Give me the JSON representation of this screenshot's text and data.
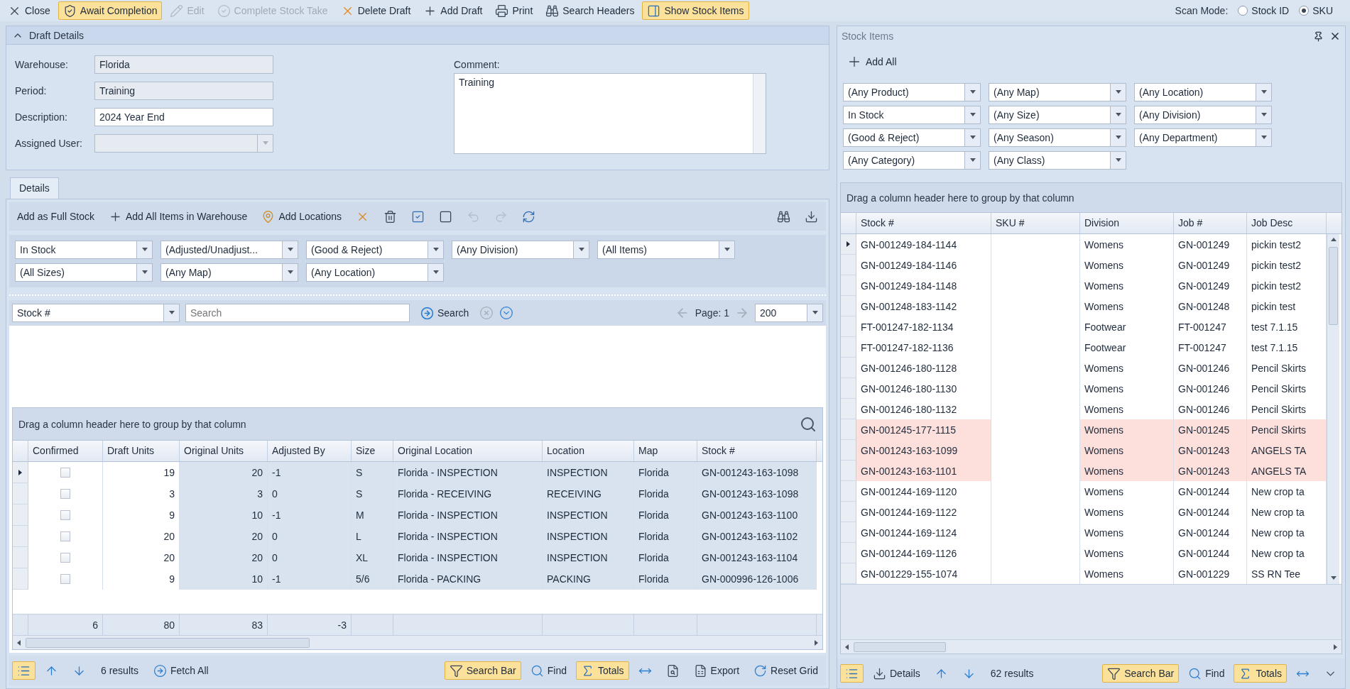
{
  "toolbar": [
    {
      "kind": "close",
      "label": "Close",
      "active": false,
      "disabled": false
    },
    {
      "kind": "await",
      "label": "Await Completion",
      "active": true,
      "disabled": false
    },
    {
      "kind": "edit",
      "label": "Edit",
      "active": false,
      "disabled": true
    },
    {
      "kind": "complete",
      "label": "Complete Stock Take",
      "active": false,
      "disabled": true
    },
    {
      "kind": "delete",
      "label": "Delete Draft",
      "active": false,
      "disabled": false
    },
    {
      "kind": "add",
      "label": "Add Draft",
      "active": false,
      "disabled": false
    },
    {
      "kind": "print",
      "label": "Print",
      "active": false,
      "disabled": false
    },
    {
      "kind": "headers",
      "label": "Search Headers",
      "active": false,
      "disabled": false
    },
    {
      "kind": "items",
      "label": "Show Stock Items",
      "active": true,
      "disabled": false
    }
  ],
  "scan_mode": {
    "label": "Scan Mode:",
    "options": [
      {
        "label": "Stock ID",
        "selected": false
      },
      {
        "label": "SKU",
        "selected": true
      }
    ]
  },
  "draft_details": {
    "title": "Draft Details",
    "expanded": true,
    "fields": [
      {
        "label": "Warehouse:",
        "value": "Florida",
        "kind": "readonly"
      },
      {
        "label": "Period:",
        "value": "Training",
        "kind": "readonly"
      },
      {
        "label": "Description:",
        "value": "2024 Year End",
        "kind": "text"
      },
      {
        "label": "Assigned User:",
        "kind": "dropdown"
      }
    ],
    "comment": {
      "label": "Comment:",
      "value": "Training"
    }
  },
  "tabs": [
    {
      "label": "Details",
      "selected": true
    }
  ],
  "details_toolbar": [
    {
      "kind": "fullstock",
      "label": "Add as Full Stock",
      "disabled": false
    },
    {
      "kind": "addall",
      "label": "Add All Items in Warehouse",
      "disabled": false
    },
    {
      "kind": "locations",
      "label": "Add Locations",
      "disabled": false
    },
    {
      "kind": "cancel",
      "disabled": false
    },
    {
      "kind": "trash",
      "disabled": false
    },
    {
      "kind": "checkall",
      "disabled": false
    },
    {
      "kind": "uncheckall",
      "disabled": false
    },
    {
      "kind": "undo",
      "disabled": true
    },
    {
      "kind": "redo",
      "disabled": true
    },
    {
      "kind": "refresh",
      "disabled": false
    },
    {
      "kind": "binoculars",
      "disabled": false
    },
    {
      "kind": "download",
      "disabled": false
    }
  ],
  "filters": [
    "In Stock",
    "(Adjusted/Unadjust...",
    "(Good & Reject)",
    "(Any Division)",
    "(All Items)",
    "(All Sizes)",
    "(Any Map)",
    "(Any Location)"
  ],
  "search": {
    "field": "Stock #",
    "placeholder": "Search",
    "button": "Search",
    "page": "Page: 1",
    "page_size": "200"
  },
  "grid": {
    "group_hint": "Drag a column header here to group by that column",
    "columns": [
      {
        "label": "Confirmed",
        "kind": "check",
        "editable": true
      },
      {
        "label": "Draft Units",
        "kind": "number",
        "editable": true
      },
      {
        "label": "Original Units",
        "kind": "number",
        "editable": false
      },
      {
        "label": "Adjusted By",
        "kind": "text",
        "editable": false
      },
      {
        "label": "Size",
        "kind": "text",
        "editable": false
      },
      {
        "label": "Original Location",
        "kind": "text",
        "editable": false
      },
      {
        "label": "Location",
        "kind": "text",
        "editable": false
      },
      {
        "label": "Map",
        "kind": "text",
        "editable": false
      },
      {
        "label": "Stock #",
        "kind": "text",
        "editable": false
      }
    ],
    "rows": [
      {
        "selected": true,
        "confirmed": false,
        "values": [
          "19",
          "20",
          "-1",
          "S",
          "Florida - INSPECTION",
          "INSPECTION",
          "Florida",
          "GN-001243-163-1098"
        ]
      },
      {
        "selected": false,
        "confirmed": false,
        "values": [
          "3",
          "3",
          "0",
          "S",
          "Florida - RECEIVING",
          "RECEIVING",
          "Florida",
          "GN-001243-163-1098"
        ]
      },
      {
        "selected": false,
        "confirmed": false,
        "values": [
          "9",
          "10",
          "-1",
          "M",
          "Florida - INSPECTION",
          "INSPECTION",
          "Florida",
          "GN-001243-163-1100"
        ]
      },
      {
        "selected": false,
        "confirmed": false,
        "values": [
          "20",
          "20",
          "0",
          "L",
          "Florida - INSPECTION",
          "INSPECTION",
          "Florida",
          "GN-001243-163-1102"
        ]
      },
      {
        "selected": false,
        "confirmed": false,
        "values": [
          "20",
          "20",
          "0",
          "XL",
          "Florida - INSPECTION",
          "INSPECTION",
          "Florida",
          "GN-001243-163-1104"
        ]
      },
      {
        "selected": false,
        "confirmed": false,
        "values": [
          "9",
          "10",
          "-1",
          "5/6",
          "Florida - PACKING",
          "PACKING",
          "Florida",
          "GN-000996-126-1006"
        ]
      }
    ],
    "totals": [
      "6",
      "80",
      "83",
      "-3"
    ]
  },
  "grid_bar": [
    {
      "kind": "list",
      "active": true
    },
    {
      "kind": "up",
      "active": false
    },
    {
      "kind": "down",
      "active": false
    },
    {
      "kind": "count",
      "label": "6 results",
      "active": false
    },
    {
      "kind": "fetch",
      "label": "Fetch All",
      "active": false
    },
    {
      "kind": "searchbar",
      "label": "Search Bar",
      "active": true
    },
    {
      "kind": "find",
      "label": "Find",
      "active": false
    },
    {
      "kind": "totals",
      "label": "Totals",
      "active": true
    },
    {
      "kind": "fit",
      "active": false
    },
    {
      "kind": "preview",
      "active": false
    },
    {
      "kind": "export",
      "label": "Export",
      "active": false
    },
    {
      "kind": "reset",
      "label": "Reset Grid",
      "active": false
    }
  ],
  "stock_panel": {
    "title": "Stock Items",
    "add_all": "Add All",
    "filters": [
      "(Any Product)",
      "(Any Map)",
      "(Any Location)",
      "In Stock",
      "(Any Size)",
      "(Any Division)",
      "(Good & Reject)",
      "(Any Season)",
      "(Any Department)",
      "(Any Category)",
      "(Any Class)"
    ],
    "group_hint": "Drag a column header here to group by that column",
    "columns": [
      {
        "label": "Stock #",
        "kind": "text"
      },
      {
        "label": "SKU #",
        "kind": "blank"
      },
      {
        "label": "Division",
        "kind": "text"
      },
      {
        "label": "Job #",
        "kind": "text"
      },
      {
        "label": "Job Desc",
        "kind": "text"
      }
    ],
    "rows": [
      {
        "stock": "GN-001249-184-1144",
        "division": "Womens",
        "job": "GN-001249",
        "desc": "pickin test2",
        "selected": true,
        "highlighted": false
      },
      {
        "stock": "GN-001249-184-1146",
        "division": "Womens",
        "job": "GN-001249",
        "desc": "pickin test2",
        "selected": false,
        "highlighted": false
      },
      {
        "stock": "GN-001249-184-1148",
        "division": "Womens",
        "job": "GN-001249",
        "desc": "pickin test2",
        "selected": false,
        "highlighted": false
      },
      {
        "stock": "GN-001248-183-1142",
        "division": "Womens",
        "job": "GN-001248",
        "desc": "pickin test",
        "selected": false,
        "highlighted": false
      },
      {
        "stock": "FT-001247-182-1134",
        "division": "Footwear",
        "job": "FT-001247",
        "desc": "test 7.1.15",
        "selected": false,
        "highlighted": false
      },
      {
        "stock": "FT-001247-182-1136",
        "division": "Footwear",
        "job": "FT-001247",
        "desc": "test 7.1.15",
        "selected": false,
        "highlighted": false
      },
      {
        "stock": "GN-001246-180-1128",
        "division": "Womens",
        "job": "GN-001246",
        "desc": "Pencil Skirts",
        "selected": false,
        "highlighted": false
      },
      {
        "stock": "GN-001246-180-1130",
        "division": "Womens",
        "job": "GN-001246",
        "desc": "Pencil Skirts",
        "selected": false,
        "highlighted": false
      },
      {
        "stock": "GN-001246-180-1132",
        "division": "Womens",
        "job": "GN-001246",
        "desc": "Pencil Skirts",
        "selected": false,
        "highlighted": false
      },
      {
        "stock": "GN-001245-177-1115",
        "division": "Womens",
        "job": "GN-001245",
        "desc": "Pencil Skirts",
        "selected": false,
        "highlighted": true
      },
      {
        "stock": "GN-001243-163-1099",
        "division": "Womens",
        "job": "GN-001243",
        "desc": "ANGELS TA",
        "selected": false,
        "highlighted": true
      },
      {
        "stock": "GN-001243-163-1101",
        "division": "Womens",
        "job": "GN-001243",
        "desc": "ANGELS TA",
        "selected": false,
        "highlighted": true
      },
      {
        "stock": "GN-001244-169-1120",
        "division": "Womens",
        "job": "GN-001244",
        "desc": "New crop ta",
        "selected": false,
        "highlighted": false
      },
      {
        "stock": "GN-001244-169-1122",
        "division": "Womens",
        "job": "GN-001244",
        "desc": "New crop ta",
        "selected": false,
        "highlighted": false
      },
      {
        "stock": "GN-001244-169-1124",
        "division": "Womens",
        "job": "GN-001244",
        "desc": "New crop ta",
        "selected": false,
        "highlighted": false
      },
      {
        "stock": "GN-001244-169-1126",
        "division": "Womens",
        "job": "GN-001244",
        "desc": "New crop ta",
        "selected": false,
        "highlighted": false
      },
      {
        "stock": "GN-001229-155-1074",
        "division": "Womens",
        "job": "GN-001229",
        "desc": "SS RN Tee",
        "selected": false,
        "highlighted": false
      }
    ],
    "bar": [
      {
        "kind": "list",
        "active": true
      },
      {
        "kind": "details",
        "label": "Details",
        "active": false
      },
      {
        "kind": "up",
        "active": false
      },
      {
        "kind": "down",
        "active": false
      },
      {
        "kind": "count",
        "label": "62 results",
        "active": false
      },
      {
        "kind": "searchbar",
        "label": "Search Bar",
        "active": true
      },
      {
        "kind": "find",
        "label": "Find",
        "active": false
      },
      {
        "kind": "totals",
        "label": "Totals",
        "active": true
      },
      {
        "kind": "fit",
        "active": false
      },
      {
        "kind": "more",
        "active": false
      }
    ]
  }
}
